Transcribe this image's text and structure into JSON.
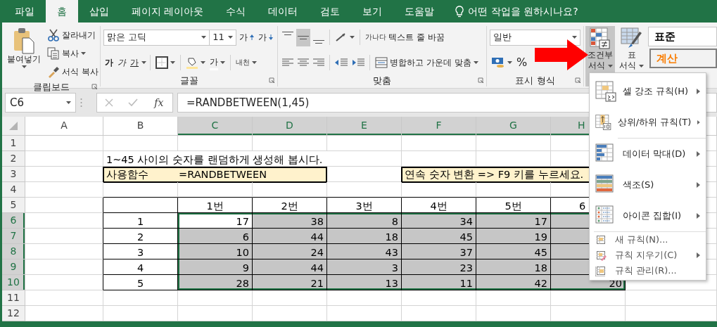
{
  "tabs": [
    {
      "label": "파일",
      "selected": false
    },
    {
      "label": "홈",
      "selected": true
    },
    {
      "label": "삽입",
      "selected": false
    },
    {
      "label": "페이지 레이아웃",
      "selected": false
    },
    {
      "label": "수식",
      "selected": false
    },
    {
      "label": "데이터",
      "selected": false
    },
    {
      "label": "검토",
      "selected": false
    },
    {
      "label": "보기",
      "selected": false
    },
    {
      "label": "도움말",
      "selected": false
    }
  ],
  "tell_me": "어떤 작업을 원하시나요?",
  "ribbon": {
    "clipboard": {
      "paste": "붙여넣기",
      "cut": "잘라내기",
      "copy": "복사",
      "format_painter": "서식 복사",
      "label": "클립보드"
    },
    "font": {
      "font_name": "맑은 고딕",
      "font_size": "11",
      "grow": "가",
      "shrink": "가",
      "bold": "가",
      "italic": "가",
      "underline": "가",
      "font_color": "가",
      "phonetic": "내천",
      "label": "글꼴"
    },
    "alignment": {
      "vertical_align": [
        {
          "selected": false
        },
        {
          "selected": true
        },
        {
          "selected": false
        }
      ],
      "wrap_icon": "가나다",
      "wrap_text": "텍스트 줄 바꿈",
      "merge": "병합하고 가운데 맞춤",
      "label": "맞춤"
    },
    "number": {
      "format": "일반",
      "percent": "%",
      "label": "표시 형식"
    },
    "styles": {
      "conditional_format": {
        "lines": [
          "조건부",
          "서식"
        ],
        "pressed": true
      },
      "table_format": {
        "lines": [
          "표",
          "서식"
        ]
      },
      "gallery": [
        {
          "label": "표준",
          "kind": "normal"
        },
        {
          "label": "계산",
          "kind": "calculation"
        }
      ]
    }
  },
  "formula_bar": {
    "name_box": "C6",
    "fx": "fx",
    "formula": "=RANDBETWEEN(1,45)"
  },
  "columns": [
    {
      "label": "A",
      "selected": false
    },
    {
      "label": "B",
      "selected": false
    },
    {
      "label": "C",
      "selected": true
    },
    {
      "label": "D",
      "selected": true
    },
    {
      "label": "E",
      "selected": true
    },
    {
      "label": "F",
      "selected": true
    },
    {
      "label": "G",
      "selected": true
    },
    {
      "label": "H",
      "selected": true
    }
  ],
  "rows": [
    {
      "header": "1",
      "kind": "blank",
      "selected": false
    },
    {
      "header": "2",
      "kind": "note",
      "selected": false,
      "text": "1~45 사이의 숫자를 랜덤하게 생성해 봅시다."
    },
    {
      "header": "3",
      "kind": "boxes",
      "selected": false,
      "boxes": [
        {
          "label": "사용함수",
          "value": "=RANDBETWEEN"
        },
        {
          "label": "연속 숫자 변환 => F9 키를 누르세요."
        }
      ]
    },
    {
      "header": "4",
      "kind": "blank",
      "selected": false
    },
    {
      "header": "5",
      "kind": "table_head",
      "selected": false,
      "headings": [
        "1번",
        "2번",
        "3번",
        "4번",
        "5번",
        "6"
      ]
    },
    {
      "header": "6",
      "kind": "table_row",
      "selected": true,
      "label": "1",
      "values": [
        {
          "text": "17",
          "active": true
        },
        {
          "text": "38",
          "active": false
        },
        {
          "text": "8",
          "active": false
        },
        {
          "text": "34",
          "active": false
        },
        {
          "text": "17",
          "active": false
        }
      ]
    },
    {
      "header": "7",
      "kind": "table_row",
      "selected": true,
      "label": "2",
      "values": [
        {
          "text": "6",
          "active": false
        },
        {
          "text": "44",
          "active": false
        },
        {
          "text": "18",
          "active": false
        },
        {
          "text": "45",
          "active": false
        },
        {
          "text": "19",
          "active": false
        }
      ]
    },
    {
      "header": "8",
      "kind": "table_row",
      "selected": true,
      "label": "3",
      "values": [
        {
          "text": "10",
          "active": false
        },
        {
          "text": "24",
          "active": false
        },
        {
          "text": "43",
          "active": false
        },
        {
          "text": "37",
          "active": false
        },
        {
          "text": "45",
          "active": false
        }
      ]
    },
    {
      "header": "9",
      "kind": "table_row",
      "selected": true,
      "label": "4",
      "values": [
        {
          "text": "9",
          "active": false
        },
        {
          "text": "44",
          "active": false
        },
        {
          "text": "3",
          "active": false
        },
        {
          "text": "23",
          "active": false
        },
        {
          "text": "18",
          "active": false
        }
      ]
    },
    {
      "header": "10",
      "kind": "table_row",
      "selected": true,
      "label": "5",
      "values": [
        {
          "text": "28",
          "active": false
        },
        {
          "text": "21",
          "active": false
        },
        {
          "text": "13",
          "active": false
        },
        {
          "text": "11",
          "active": false
        },
        {
          "text": "42",
          "active": false
        },
        {
          "text": "20",
          "active": false
        }
      ]
    },
    {
      "header": "11",
      "kind": "blank",
      "selected": false
    },
    {
      "header": "12",
      "kind": "blank",
      "selected": false
    }
  ],
  "menu": {
    "items": [
      {
        "kind": "large",
        "label": "셀 강조 규칙(H)",
        "submenu": true
      },
      {
        "kind": "large",
        "label": "상위/하위 규칙(T)",
        "submenu": true
      },
      {
        "kind": "separator"
      },
      {
        "kind": "large",
        "label": "데이터 막대(D)",
        "submenu": true
      },
      {
        "kind": "large",
        "label": "색조(S)",
        "submenu": true
      },
      {
        "kind": "large",
        "label": "아이콘 집합(I)",
        "submenu": true
      },
      {
        "kind": "separator"
      },
      {
        "kind": "small",
        "label": "새 규칙(N)...",
        "submenu": false
      },
      {
        "kind": "small",
        "label": "규칙 지우기(C)",
        "submenu": true
      },
      {
        "kind": "small",
        "label": "규칙 관리(R)...",
        "submenu": false
      }
    ]
  }
}
